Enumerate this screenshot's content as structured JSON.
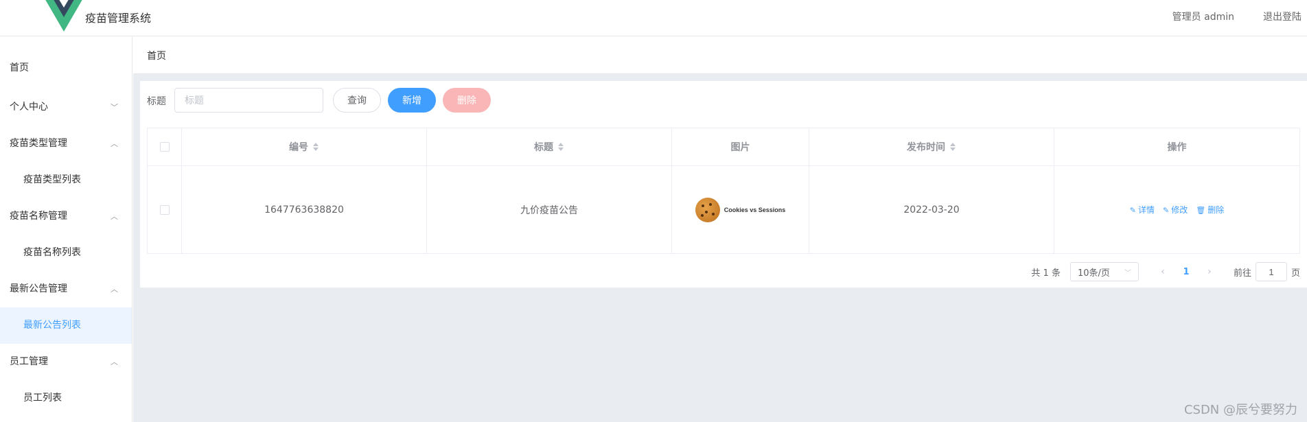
{
  "header": {
    "app_title": "疫苗管理系统",
    "admin_label": "管理员 admin",
    "logout_label": "退出登陆"
  },
  "sidebar": {
    "items": [
      {
        "label": "首页",
        "type": "top"
      },
      {
        "label": "个人中心",
        "type": "group",
        "chevron": "chevron-down"
      },
      {
        "label": "疫苗类型管理",
        "type": "group",
        "chevron": "chevron-up"
      },
      {
        "label": "疫苗类型列表",
        "type": "sub"
      },
      {
        "label": "疫苗名称管理",
        "type": "group",
        "chevron": "chevron-up"
      },
      {
        "label": "疫苗名称列表",
        "type": "sub"
      },
      {
        "label": "最新公告管理",
        "type": "group",
        "chevron": "chevron-up"
      },
      {
        "label": "最新公告列表",
        "type": "sub",
        "active": true
      },
      {
        "label": "员工管理",
        "type": "group",
        "chevron": "chevron-up"
      },
      {
        "label": "员工列表",
        "type": "sub"
      }
    ]
  },
  "breadcrumb": "首页",
  "search": {
    "label": "标题",
    "placeholder": "标题",
    "query_label": "查询",
    "add_label": "新增",
    "delete_label": "删除"
  },
  "table": {
    "headers": [
      "编号",
      "标题",
      "图片",
      "发布时间",
      "操作"
    ],
    "rows": [
      {
        "id": "1647763638820",
        "title": "九价疫苗公告",
        "image_text": "Cookies vs Sessions",
        "date": "2022-03-20",
        "actions": [
          "详情",
          "修改",
          "删除"
        ]
      }
    ]
  },
  "pagination": {
    "total": "共 1 条",
    "page_size": "10条/页",
    "current_page": "1",
    "goto_label": "前往",
    "goto_value": "1",
    "page_suffix": "页"
  },
  "watermark": "CSDN @辰兮要努力",
  "colors": {
    "primary": "#409eff",
    "danger_light": "#fab6b6",
    "logo_green": "#41b883",
    "logo_dark": "#35495e"
  }
}
